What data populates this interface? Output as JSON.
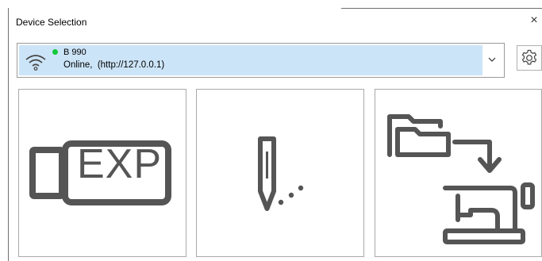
{
  "window": {
    "title": "Device Selection",
    "close_label": "×"
  },
  "device": {
    "name": "B 990",
    "status": "Online,  (http://127.0.0.1)",
    "connected": true,
    "connection_icon": "wifi-icon",
    "status_color": "#10c83a",
    "highlight_color": "#cce4f7"
  },
  "settings": {
    "icon": "gear-icon"
  },
  "tiles": [
    {
      "icon": "usb-stick-icon",
      "text": "EXP"
    },
    {
      "icon": "needle-stitch-icon"
    },
    {
      "icon": "folder-to-sewing-machine-icon"
    }
  ]
}
